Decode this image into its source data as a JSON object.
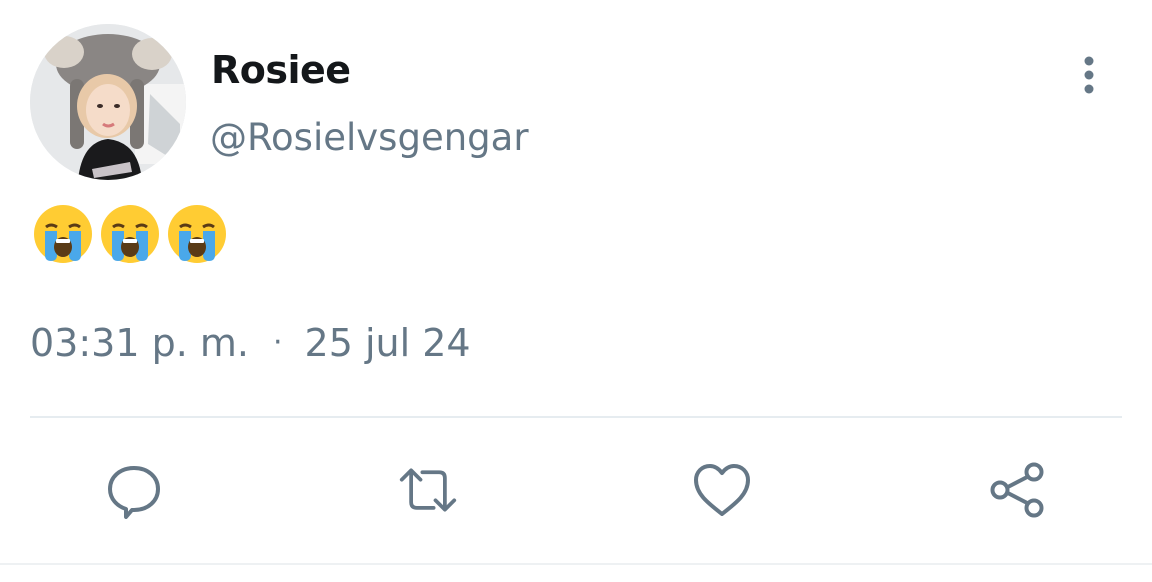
{
  "author": {
    "display_name": "Rosiee",
    "handle": "@Rosielvsgengar"
  },
  "tweet": {
    "text": "😭😭😭",
    "emoji_name": "loudly-crying-face",
    "emoji_count": 3,
    "time": "03:31 p. m.",
    "separator": "·",
    "date": "25 jul 24"
  },
  "actions": {
    "reply_icon": "speech-bubble-icon",
    "retweet_icon": "retweet-arrows-icon",
    "like_icon": "heart-icon",
    "share_icon": "share-nodes-icon",
    "more_icon": "vertical-dots-icon"
  },
  "colors": {
    "text_primary": "#14171a",
    "text_secondary": "#657786",
    "icon": "#657786",
    "divider": "#e6ecf0",
    "background": "#ffffff"
  }
}
